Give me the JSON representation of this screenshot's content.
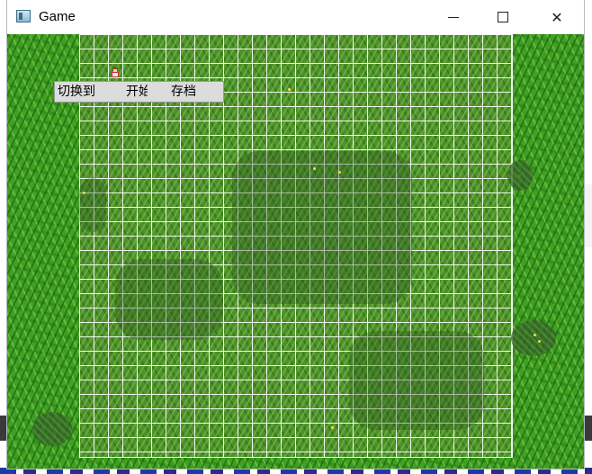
{
  "window": {
    "title": "Game"
  },
  "titlebar": {
    "minimize_icon": "minimize-icon",
    "maximize_icon": "maximize-icon",
    "close_icon": "close-icon",
    "close_glyph": "✕"
  },
  "menu": {
    "switch_label": "切换到",
    "start_label": "开始",
    "save_label": "存档"
  },
  "game": {
    "tile_size_label": "",
    "icons": {
      "character": "character-sprite-icon",
      "app": "app-window-icon"
    },
    "colors": {
      "grass": "#3fa124",
      "grid_line": "#ffffff",
      "menu_bg": "#dcdcdc"
    }
  }
}
